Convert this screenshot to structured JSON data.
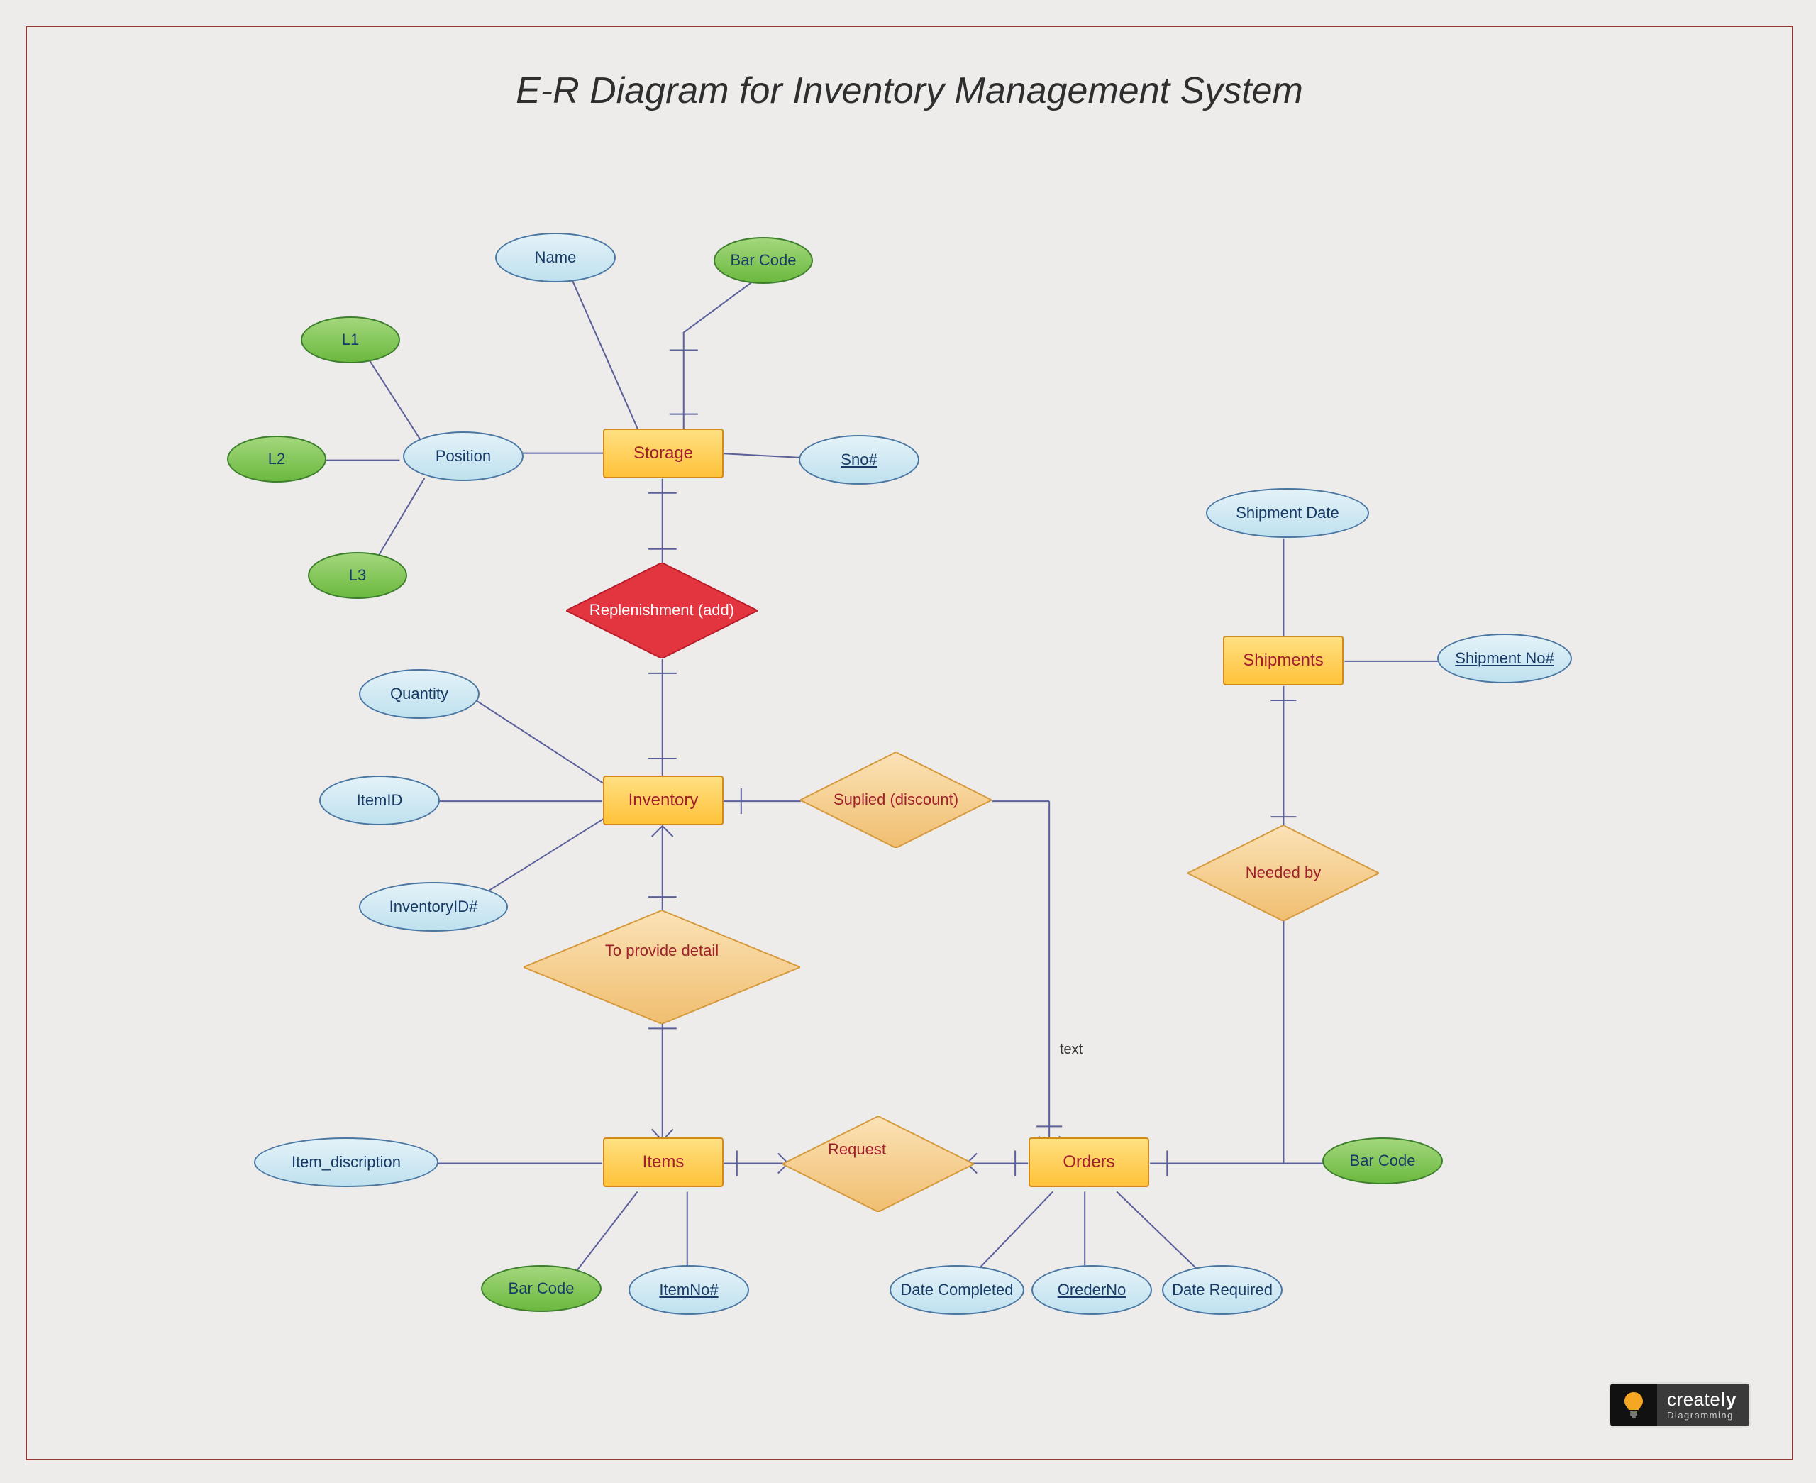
{
  "title": "E-R Diagram for Inventory Management System",
  "entities": {
    "storage": "Storage",
    "inventory": "Inventory",
    "items": "Items",
    "orders": "Orders",
    "shipments": "Shipments"
  },
  "relationships": {
    "replenishment": "Replenishment (add)",
    "supplied": "Suplied (discount)",
    "provide_detail": "To provide detail",
    "request": "Request",
    "needed_by": "Needed by"
  },
  "attributes": {
    "storage": {
      "name": "Name",
      "position": "Position",
      "sno": "Sno#",
      "barcode": "Bar Code",
      "position_sub": {
        "l1": "L1",
        "l2": "L2",
        "l3": "L3"
      }
    },
    "inventory": {
      "quantity": "Quantity",
      "item_id": "ItemID",
      "inventory_id": "InventoryID#"
    },
    "items": {
      "description": "Item_discription",
      "barcode": "Bar Code",
      "item_no": "ItemNo#"
    },
    "orders": {
      "date_completed": "Date Completed",
      "order_no": "OrederNo",
      "date_required": "Date Required",
      "barcode": "Bar Code"
    },
    "shipments": {
      "shipment_date": "Shipment Date",
      "shipment_no": "Shipment No#"
    }
  },
  "labels": {
    "edge_text": "text"
  },
  "logo": {
    "brand_main": "create",
    "brand_suffix": "ly",
    "tagline": "Diagramming"
  }
}
